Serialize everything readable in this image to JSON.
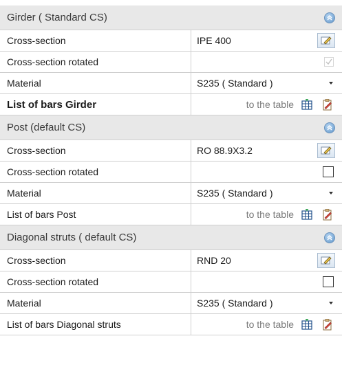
{
  "sections": [
    {
      "title": "Girder ( Standard CS)",
      "cross_section_label": "Cross-section",
      "cross_section_value": "IPE 400",
      "rotated_label": "Cross-section rotated",
      "rotated_checked": true,
      "material_label": "Material",
      "material_value": "S235 ( Standard )",
      "bars_label": "List of bars Girder",
      "bars_link": "to the table"
    },
    {
      "title": "Post (default CS)",
      "cross_section_label": "Cross-section",
      "cross_section_value": "RO 88.9X3.2",
      "rotated_label": "Cross-section rotated",
      "rotated_checked": false,
      "material_label": "Material",
      "material_value": "S235 ( Standard )",
      "bars_label": "List of bars Post",
      "bars_link": "to the table"
    },
    {
      "title": "Diagonal struts ( default CS)",
      "cross_section_label": "Cross-section",
      "cross_section_value": "RND 20",
      "rotated_label": "Cross-section rotated",
      "rotated_checked": false,
      "material_label": "Material",
      "material_value": "S235 ( Standard )",
      "bars_label": "List of bars Diagonal struts",
      "bars_link": "to the table"
    }
  ],
  "icons": {
    "collapse": "collapse-chevron-up-icon",
    "edit": "edit-pencil-icon",
    "table": "table-grid-icon",
    "clipboard": "clipboard-edit-icon",
    "dropdown": "dropdown-caret-icon"
  },
  "colors": {
    "header_bg": "#e8e8e8",
    "grid_line": "#cfcfcf",
    "accent_blue": "#5f95c9"
  }
}
